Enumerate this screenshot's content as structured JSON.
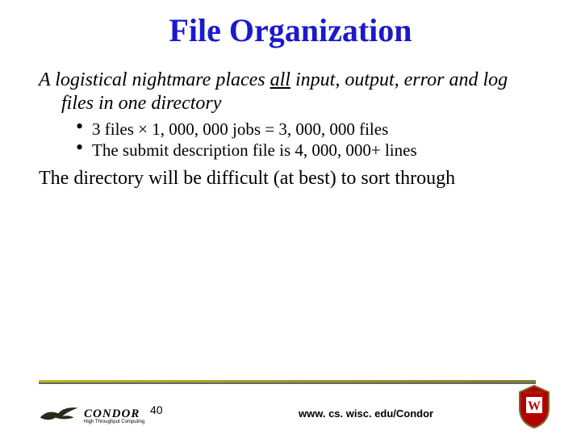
{
  "title": "File Organization",
  "para1_prefix": "A logistical nightmare places ",
  "para1_underlined": "all",
  "para1_suffix": " input, output, error and log files in one directory",
  "bullets": [
    "3 files × 1, 000, 000 jobs = 3, 000, 000 files",
    "The submit description file is 4, 000, 000+ lines"
  ],
  "para2": "The directory will be difficult (at best) to sort through",
  "footer": {
    "project": "CONDOR",
    "tagline": "High Throughput Computing",
    "page": "40",
    "url": "www. cs. wisc. edu/Condor"
  }
}
